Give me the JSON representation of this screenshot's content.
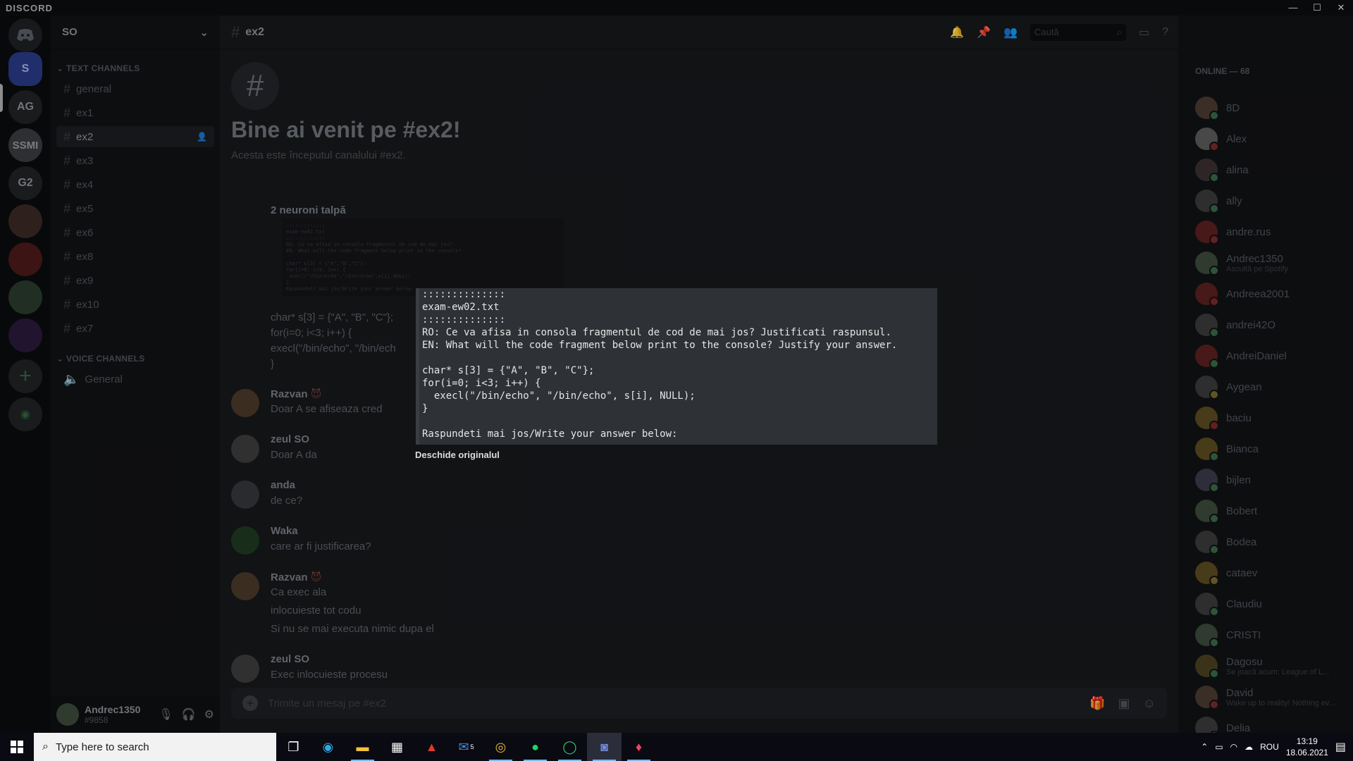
{
  "app": {
    "brand": "DISCORD",
    "min_icon": "—",
    "max_icon": "☐",
    "close_icon": "✕"
  },
  "servers": [
    {
      "label": "",
      "icon": "discord-logo-icon"
    },
    {
      "label": "S"
    },
    {
      "label": "AG"
    },
    {
      "label": "SSMI"
    },
    {
      "label": "G2"
    },
    {
      "label": ""
    },
    {
      "label": ""
    },
    {
      "label": ""
    },
    {
      "label": ""
    },
    {
      "label": "+",
      "icon": "add-server-icon"
    },
    {
      "label": "◉",
      "icon": "explore-icon"
    }
  ],
  "guild": {
    "name": "SO",
    "chevron": "⌄"
  },
  "categories": {
    "text": "TEXT CHANNELS",
    "voice": "VOICE CHANNELS",
    "caret": "⌄"
  },
  "channels": [
    "general",
    "ex1",
    "ex2",
    "ex3",
    "ex4",
    "ex5",
    "ex6",
    "ex8",
    "ex9",
    "ex10",
    "ex7"
  ],
  "voice_channels": [
    "General"
  ],
  "user": {
    "name": "Andrec1350",
    "tag": "#9858"
  },
  "chat": {
    "channel": "ex2",
    "welcome_title": "Bine ai venit pe #ex2!",
    "welcome_sub": "Acesta este începutul canalului #ex2.",
    "composer_placeholder": "Trimite un mesaj pe #ex2",
    "search_placeholder": "Caută"
  },
  "messages": [
    {
      "author": "2 neuroni talpă",
      "time": "",
      "lines": []
    },
    {
      "author": "",
      "time": "",
      "lines": [
        "char* s[3] = {\"A\", \"B\", \"C\"};",
        "for(i=0; i<3; i++) {",
        "  execl(\"/bin/echo\", \"/bin/ech",
        "}"
      ]
    },
    {
      "author": "Razvan",
      "time": "",
      "lines": [
        "Doar A se afiseaza cred"
      ]
    },
    {
      "author": "zeul SO",
      "time": "",
      "lines": [
        "Doar A da"
      ]
    },
    {
      "author": "anda",
      "time": "",
      "lines": [
        "de ce?"
      ]
    },
    {
      "author": "Waka",
      "time": "",
      "lines": [
        "care ar fi justificarea?"
      ]
    },
    {
      "author": "Razvan",
      "time": "",
      "lines": [
        "Ca exec ala",
        "inlocuieste tot codu",
        "Si nu se mai executa nimic dupa el"
      ]
    },
    {
      "author": "zeul SO",
      "time": "",
      "lines": [
        "Exec inlocuieste procesu"
      ]
    }
  ],
  "members": {
    "header": "ONLINE — 68",
    "list": [
      {
        "name": "8D",
        "status": ""
      },
      {
        "name": "Alex",
        "status": ""
      },
      {
        "name": "alina",
        "status": ""
      },
      {
        "name": "ally",
        "status": ""
      },
      {
        "name": "andre.rus",
        "status": ""
      },
      {
        "name": "Andrec1350",
        "status": "Ascultă pe Spotify"
      },
      {
        "name": "Andreea2001",
        "status": ""
      },
      {
        "name": "andrei42O",
        "status": ""
      },
      {
        "name": "AndreiDaniel",
        "status": ""
      },
      {
        "name": "Aygean",
        "status": ""
      },
      {
        "name": "baciu",
        "status": ""
      },
      {
        "name": "Bianca",
        "status": ""
      },
      {
        "name": "bijlen",
        "status": ""
      },
      {
        "name": "Bobert",
        "status": ""
      },
      {
        "name": "Bodea",
        "status": ""
      },
      {
        "name": "cataev",
        "status": ""
      },
      {
        "name": "Claudiu",
        "status": ""
      },
      {
        "name": "CRISTI",
        "status": ""
      },
      {
        "name": "Dagosu",
        "status": "Se joacă acum: League of L..."
      },
      {
        "name": "David",
        "status": "Wake up to reality! Nothing ev..."
      },
      {
        "name": "Delia",
        "status": ""
      }
    ]
  },
  "preview": {
    "text": "::::::::::::::\nexam-ew02.txt\n::::::::::::::\nRO: Ce va afisa in consola fragmentul de cod de mai jos? Justificati raspunsul.\nEN: What will the code fragment below print to the console? Justify your answer.\n\nchar* s[3] = {\"A\", \"B\", \"C\"};\nfor(i=0; i<3; i++) {\n  execl(\"/bin/echo\", \"/bin/echo\", s[i], NULL);\n}\n\nRaspundeti mai jos/Write your answer below:",
    "open_original": "Deschide originalul"
  },
  "taskbar": {
    "search_placeholder": "Type here to search",
    "language": "ROU",
    "time": "13:19",
    "date": "18.06.2021",
    "mail_badge": "5"
  }
}
